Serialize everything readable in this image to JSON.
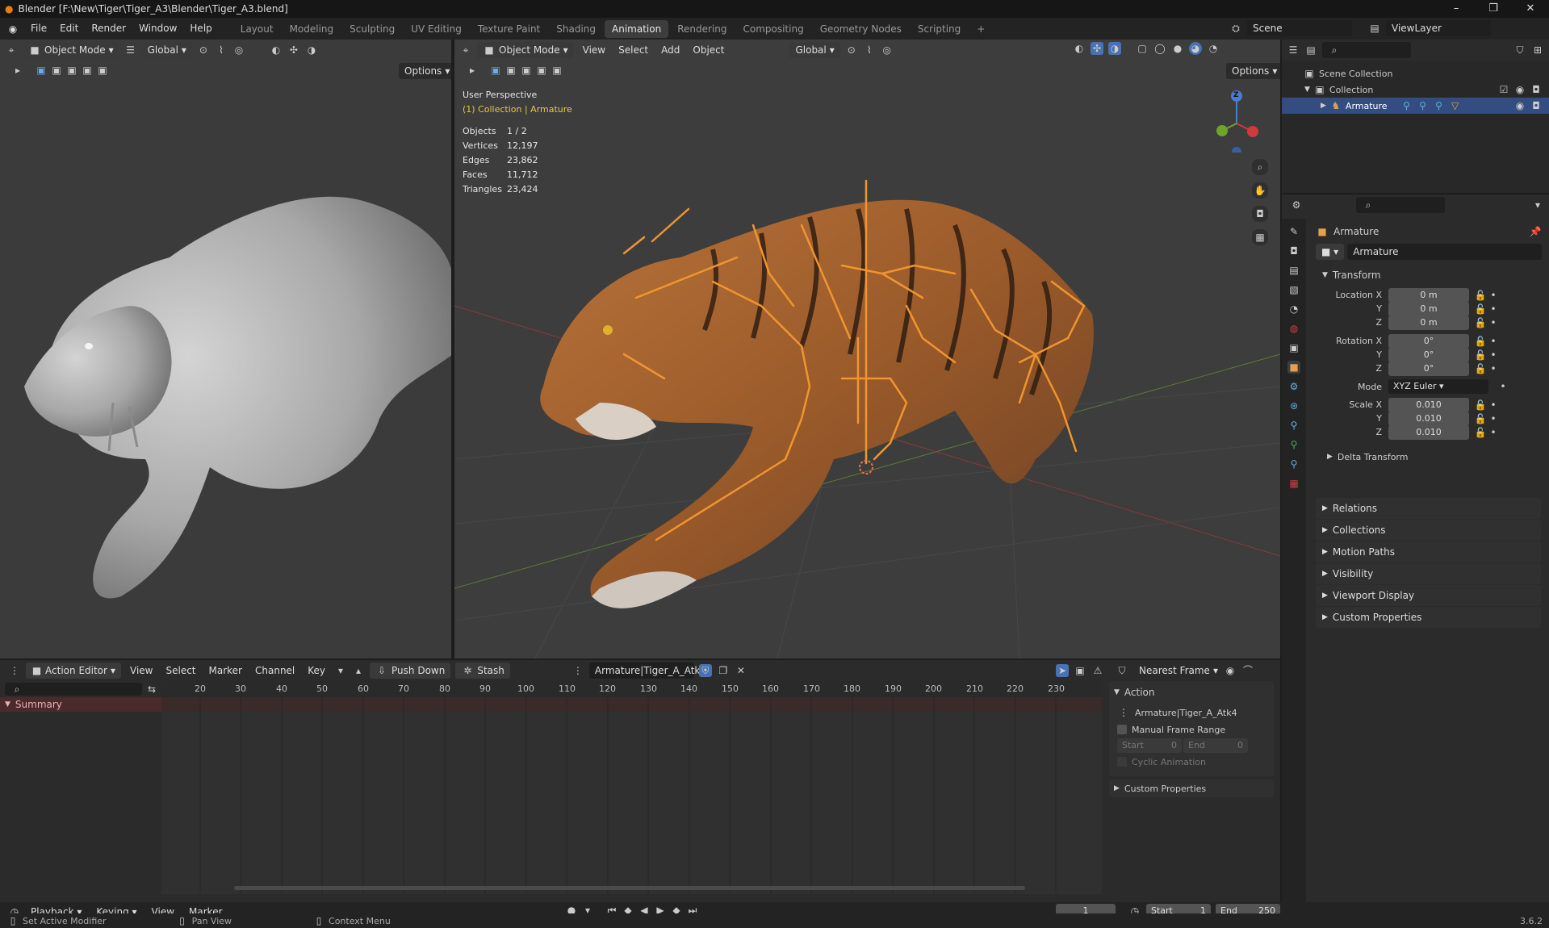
{
  "window": {
    "title": "Blender [F:\\New\\Tiger\\Tiger_A3\\Blender\\Tiger_A3.blend]",
    "minimize": "–",
    "maximize": "❐",
    "close": "✕"
  },
  "topbar": {
    "menus": [
      "File",
      "Edit",
      "Render",
      "Window",
      "Help"
    ],
    "workspaces": [
      "Layout",
      "Modeling",
      "Sculpting",
      "UV Editing",
      "Texture Paint",
      "Shading",
      "Animation",
      "Rendering",
      "Compositing",
      "Geometry Nodes",
      "Scripting"
    ],
    "active_workspace": "Animation",
    "add_tab": "+",
    "scene": "Scene",
    "view_layer": "ViewLayer"
  },
  "left_viewport": {
    "mode": "Object Mode",
    "orientation": "Global",
    "options": "Options"
  },
  "main_viewport": {
    "mode": "Object Mode",
    "menus": [
      "View",
      "Select",
      "Add",
      "Object"
    ],
    "orientation": "Global",
    "options": "Options",
    "perspective": "User Perspective",
    "collection": "(1) Collection | Armature",
    "stats": [
      {
        "label": "Objects",
        "value": "1 / 2"
      },
      {
        "label": "Vertices",
        "value": "12,197"
      },
      {
        "label": "Edges",
        "value": "23,862"
      },
      {
        "label": "Faces",
        "value": "11,712"
      },
      {
        "label": "Triangles",
        "value": "23,424"
      }
    ],
    "gizmo": {
      "z": "Z"
    }
  },
  "outliner": {
    "scene_collection": "Scene Collection",
    "collection": "Collection",
    "armature": "Armature"
  },
  "properties": {
    "object_name": "Armature",
    "data_name": "Armature",
    "transform": "Transform",
    "location": {
      "label": "Location X",
      "x": "0 m",
      "y": "0 m",
      "z": "0 m"
    },
    "rotation": {
      "label": "Rotation X",
      "x": "0°",
      "y": "0°",
      "z": "0°"
    },
    "mode_label": "Mode",
    "mode_value": "XYZ Euler",
    "scale": {
      "label": "Scale X",
      "x": "0.010",
      "y": "0.010",
      "z": "0.010"
    },
    "axis_y": "Y",
    "axis_z": "Z",
    "delta": "Delta Transform",
    "sections": [
      "Relations",
      "Collections",
      "Motion Paths",
      "Visibility",
      "Viewport Display",
      "Custom Properties"
    ]
  },
  "action_editor": {
    "mode": "Action Editor",
    "menus": [
      "View",
      "Select",
      "Marker",
      "Channel",
      "Key"
    ],
    "push_down": "Push Down",
    "stash": "Stash",
    "action_name": "Armature|Tiger_A_Atk4",
    "snap": "Nearest Frame",
    "summary": "Summary",
    "frame_ticks": [
      "20",
      "30",
      "40",
      "50",
      "60",
      "70",
      "80",
      "90",
      "100",
      "110",
      "120",
      "130",
      "140",
      "150",
      "160",
      "170",
      "180",
      "190",
      "200",
      "210",
      "220",
      "230"
    ],
    "panel": {
      "action_header": "Action",
      "action_name": "Armature|Tiger_A_Atk4",
      "manual_range": "Manual Frame Range",
      "start_label": "Start",
      "start_value": "0",
      "end_label": "End",
      "end_value": "0",
      "cyclic": "Cyclic Animation",
      "custom_props": "Custom Properties"
    }
  },
  "timeline": {
    "menus": [
      "Playback",
      "Keying",
      "View",
      "Marker"
    ],
    "current_frame": "1",
    "start_label": "Start",
    "start": "1",
    "end_label": "End",
    "end": "250"
  },
  "statusbar": {
    "hint1": "Set Active Modifier",
    "hint2": "Pan View",
    "hint3": "Context Menu",
    "version": "3.6.2"
  }
}
